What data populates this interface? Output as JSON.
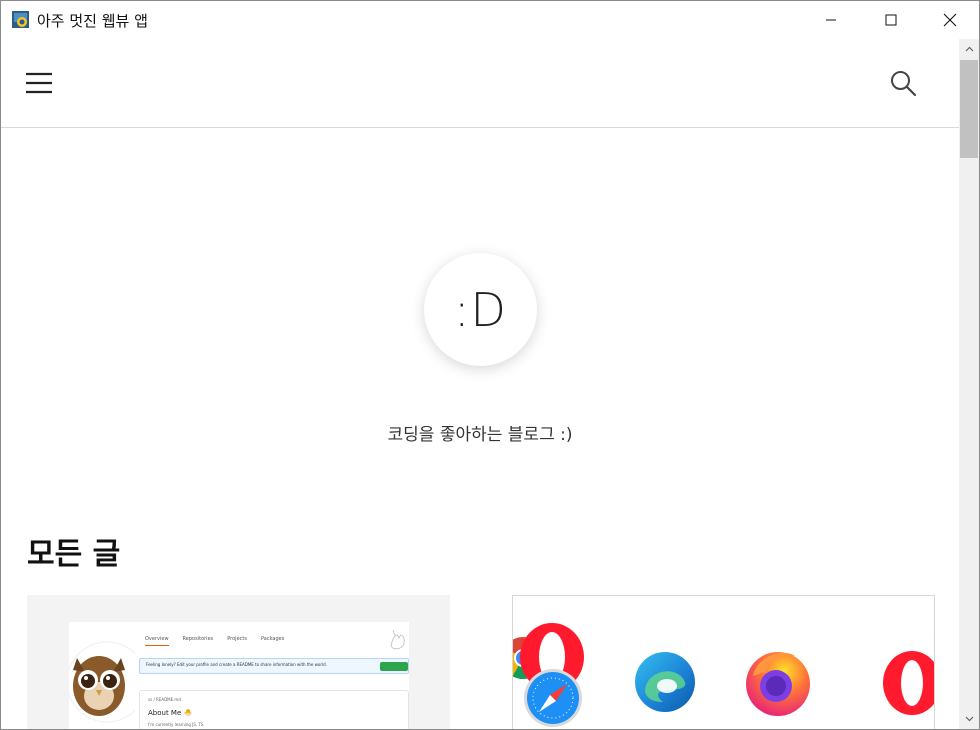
{
  "window": {
    "title": "아주 멋진 웹뷰 앱"
  },
  "profile": {
    "avatar_text": ":D",
    "tagline": "코딩을 좋아하는 블로그 :)"
  },
  "posts": {
    "section_title": "모든 글",
    "card1_thumb": {
      "tabs": [
        "Overview",
        "Repositories",
        "Projects",
        "Packages"
      ],
      "banner": "Feeling lonely? Edit your profile and create a README to share information with the world.",
      "box_header": "ss / README.md",
      "box_title": "About Me 🐣",
      "box_line": "I'm currently learning JS, TS"
    },
    "card2_thumb": {
      "icons": [
        "chrome-icon",
        "safari-icon",
        "opera-icon",
        "edge-icon",
        "firefox-icon",
        "opera-icon"
      ]
    }
  },
  "colors": {
    "divider": "#d8d8d8",
    "card_bg": "#f3f3f3",
    "scroll_thumb": "#c1c1c1"
  }
}
